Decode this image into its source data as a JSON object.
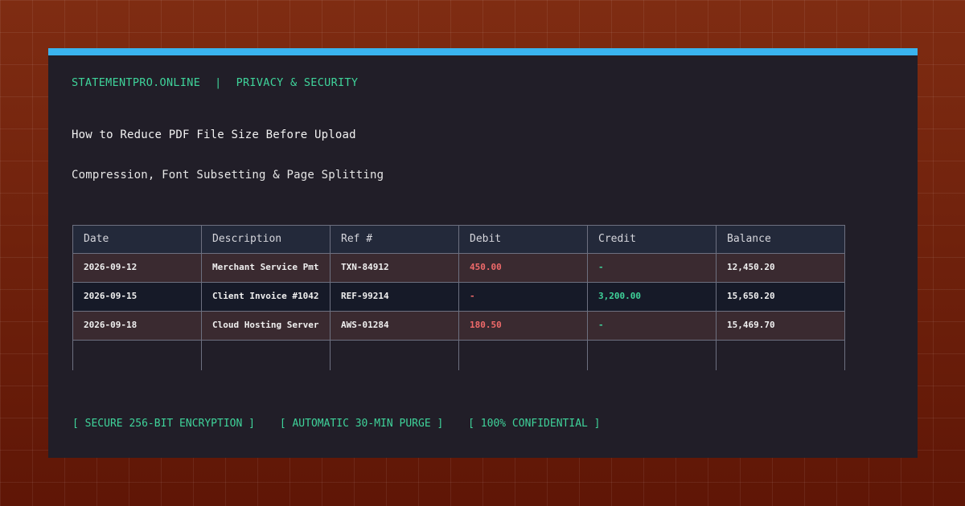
{
  "brand": {
    "site": "STATEMENTPRO.ONLINE",
    "separator": "|",
    "section": "PRIVACY & SECURITY"
  },
  "article": {
    "title": "How to Reduce PDF File Size Before Upload",
    "subtitle": "Compression, Font Subsetting & Page Splitting"
  },
  "table": {
    "columns": [
      "Date",
      "Description",
      "Ref #",
      "Debit",
      "Credit",
      "Balance"
    ],
    "rows": [
      {
        "date": "2026-09-12",
        "description": "Merchant Service Pmt",
        "ref": "TXN-84912",
        "debit": "450.00",
        "credit": "-",
        "balance": "12,450.20"
      },
      {
        "date": "2026-09-15",
        "description": "Client Invoice #1042",
        "ref": "REF-99214",
        "debit": "-",
        "credit": "3,200.00",
        "balance": "15,650.20"
      },
      {
        "date": "2026-09-18",
        "description": "Cloud Hosting Server",
        "ref": "AWS-01284",
        "debit": "180.50",
        "credit": "-",
        "balance": "15,469.70"
      }
    ]
  },
  "footer": {
    "badges": [
      "[ SECURE 256-BIT ENCRYPTION ]",
      "[ AUTOMATIC 30-MIN PURGE ]",
      "[ 100% CONFIDENTIAL ]"
    ]
  },
  "colors": {
    "accent_bar": "#3ab4ef",
    "brand_green": "#3fd39a",
    "debit_red": "#f06a6a",
    "card_background": "#211e28",
    "page_background": "#6e1e0c"
  }
}
